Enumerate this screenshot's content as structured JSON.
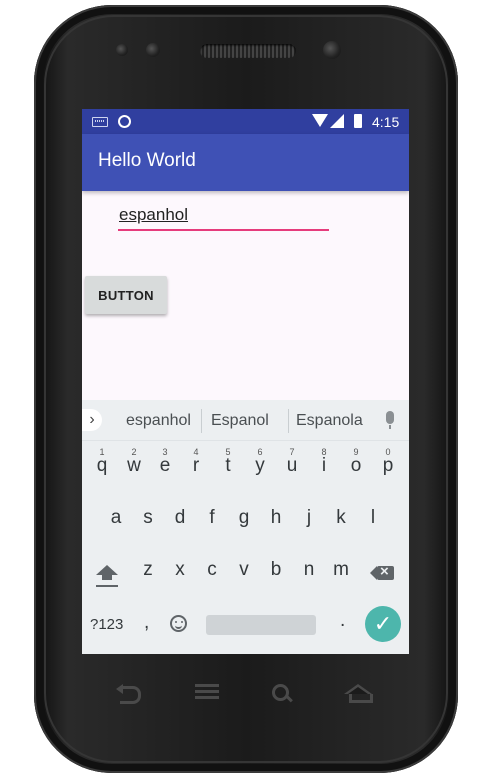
{
  "status_bar": {
    "time": "4:15",
    "icons": [
      "keyboard-icon",
      "sync-ring-icon",
      "wifi-icon",
      "signal-icon",
      "battery-icon"
    ]
  },
  "app_bar": {
    "title": "Hello World"
  },
  "text_field": {
    "value": "espanhol"
  },
  "button": {
    "label": "BUTTON"
  },
  "keyboard": {
    "suggestions": [
      "espanhol",
      "Espanol",
      "Espanola"
    ],
    "expand_label": "›",
    "row1": [
      {
        "key": "q",
        "num": "1"
      },
      {
        "key": "w",
        "num": "2"
      },
      {
        "key": "e",
        "num": "3"
      },
      {
        "key": "r",
        "num": "4"
      },
      {
        "key": "t",
        "num": "5"
      },
      {
        "key": "y",
        "num": "6"
      },
      {
        "key": "u",
        "num": "7"
      },
      {
        "key": "i",
        "num": "8"
      },
      {
        "key": "o",
        "num": "9"
      },
      {
        "key": "p",
        "num": "0"
      }
    ],
    "row2": [
      "a",
      "s",
      "d",
      "f",
      "g",
      "h",
      "j",
      "k",
      "l"
    ],
    "row3": [
      "z",
      "x",
      "c",
      "v",
      "b",
      "n",
      "m"
    ],
    "symbols_label": "?123",
    "comma": ",",
    "period": ".",
    "enter_glyph": "✓"
  },
  "colors": {
    "status_bar": "#303f9f",
    "app_bar": "#3f51b5",
    "accent_underline": "#e63c7c",
    "enter_key": "#4db6ac"
  }
}
